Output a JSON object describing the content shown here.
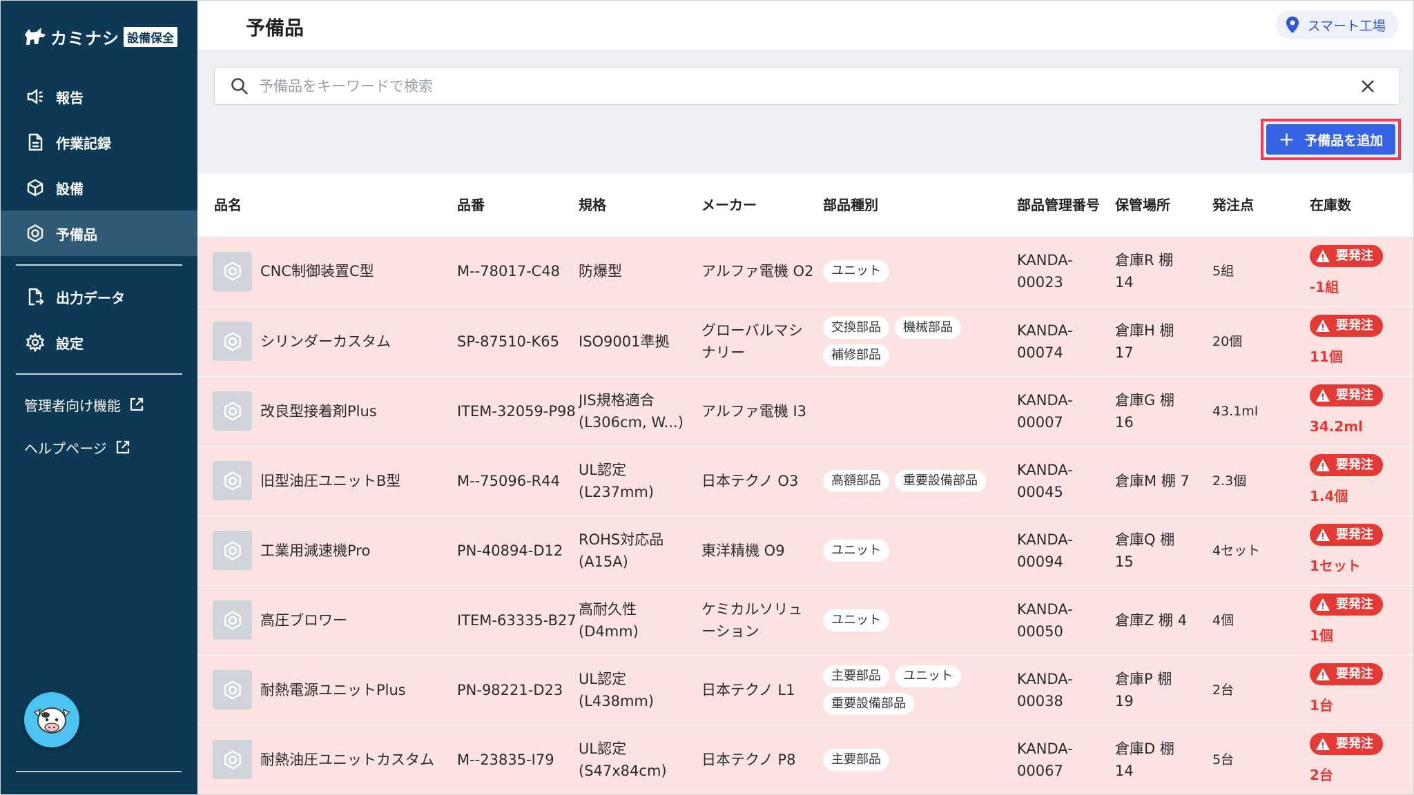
{
  "app": {
    "brand": "カミナシ",
    "brand_tag": "設備保全"
  },
  "nav": {
    "report": "報告",
    "work_log": "作業記録",
    "equipment": "設備",
    "spare_parts": "予備品",
    "export": "出力データ",
    "settings": "設定",
    "admin": "管理者向け機能",
    "help": "ヘルプページ"
  },
  "header": {
    "title": "予備品",
    "location": "スマート工場"
  },
  "search": {
    "placeholder": "予備品をキーワードで検索"
  },
  "actions": {
    "add_label": "予備品を追加"
  },
  "table": {
    "columns": {
      "name": "品名",
      "part_no": "品番",
      "spec": "規格",
      "maker": "メーカー",
      "type": "部品種別",
      "mgmt_no": "部品管理番号",
      "location": "保管場所",
      "order_point": "発注点",
      "stock": "在庫数"
    },
    "order_badge": "要発注",
    "rows": [
      {
        "name": "CNC制御装置C型",
        "part_no": "M--78017-C48",
        "spec": "防爆型",
        "maker": "アルファ電機 O2",
        "tags": [
          "ユニット"
        ],
        "mgmt_no": "KANDA-00023",
        "location": "倉庫R 棚 14",
        "order_point": "5組",
        "stock": "-1組"
      },
      {
        "name": "シリンダーカスタム",
        "part_no": "SP-87510-K65",
        "spec": "ISO9001準拠",
        "maker": "グローバルマシナリー",
        "tags": [
          "交換部品",
          "機械部品",
          "補修部品"
        ],
        "mgmt_no": "KANDA-00074",
        "location": "倉庫H 棚 17",
        "order_point": "20個",
        "stock": "11個"
      },
      {
        "name": "改良型接着剤Plus",
        "part_no": "ITEM-32059-P98",
        "spec": "JIS規格適合 (L306cm, W...)",
        "maker": "アルファ電機 I3",
        "tags": [],
        "mgmt_no": "KANDA-00007",
        "location": "倉庫G 棚 16",
        "order_point": "43.1ml",
        "stock": "34.2ml"
      },
      {
        "name": "旧型油圧ユニットB型",
        "part_no": "M--75096-R44",
        "spec": "UL認定 (L237mm)",
        "maker": "日本テクノ O3",
        "tags": [
          "高額部品",
          "重要設備部品"
        ],
        "mgmt_no": "KANDA-00045",
        "location": "倉庫M 棚 7",
        "order_point": "2.3個",
        "stock": "1.4個"
      },
      {
        "name": "工業用減速機Pro",
        "part_no": "PN-40894-D12",
        "spec": "ROHS対応品 (A15A)",
        "maker": "東洋精機 O9",
        "tags": [
          "ユニット"
        ],
        "mgmt_no": "KANDA-00094",
        "location": "倉庫Q 棚 15",
        "order_point": "4セット",
        "stock": "1セット"
      },
      {
        "name": "高圧ブロワー",
        "part_no": "ITEM-63335-B27",
        "spec": "高耐久性 (D4mm)",
        "maker": "ケミカルソリューション",
        "tags": [
          "ユニット"
        ],
        "mgmt_no": "KANDA-00050",
        "location": "倉庫Z 棚 4",
        "order_point": "4個",
        "stock": "1個"
      },
      {
        "name": "耐熱電源ユニットPlus",
        "part_no": "PN-98221-D23",
        "spec": "UL認定 (L438mm)",
        "maker": "日本テクノ L1",
        "tags": [
          "主要部品",
          "ユニット",
          "重要設備部品"
        ],
        "mgmt_no": "KANDA-00038",
        "location": "倉庫P 棚 19",
        "order_point": "2台",
        "stock": "1台"
      },
      {
        "name": "耐熱油圧ユニットカスタム",
        "part_no": "M--23835-I79",
        "spec": "UL認定 (S47x84cm)",
        "maker": "日本テクノ P8",
        "tags": [
          "主要部品"
        ],
        "mgmt_no": "KANDA-00067",
        "location": "倉庫D 棚 14",
        "order_point": "5台",
        "stock": "2台"
      }
    ]
  },
  "colors": {
    "sidebar": "#0d3954",
    "primary": "#3563e4",
    "alert": "#e53935",
    "row_bg": "#fde2e2"
  }
}
